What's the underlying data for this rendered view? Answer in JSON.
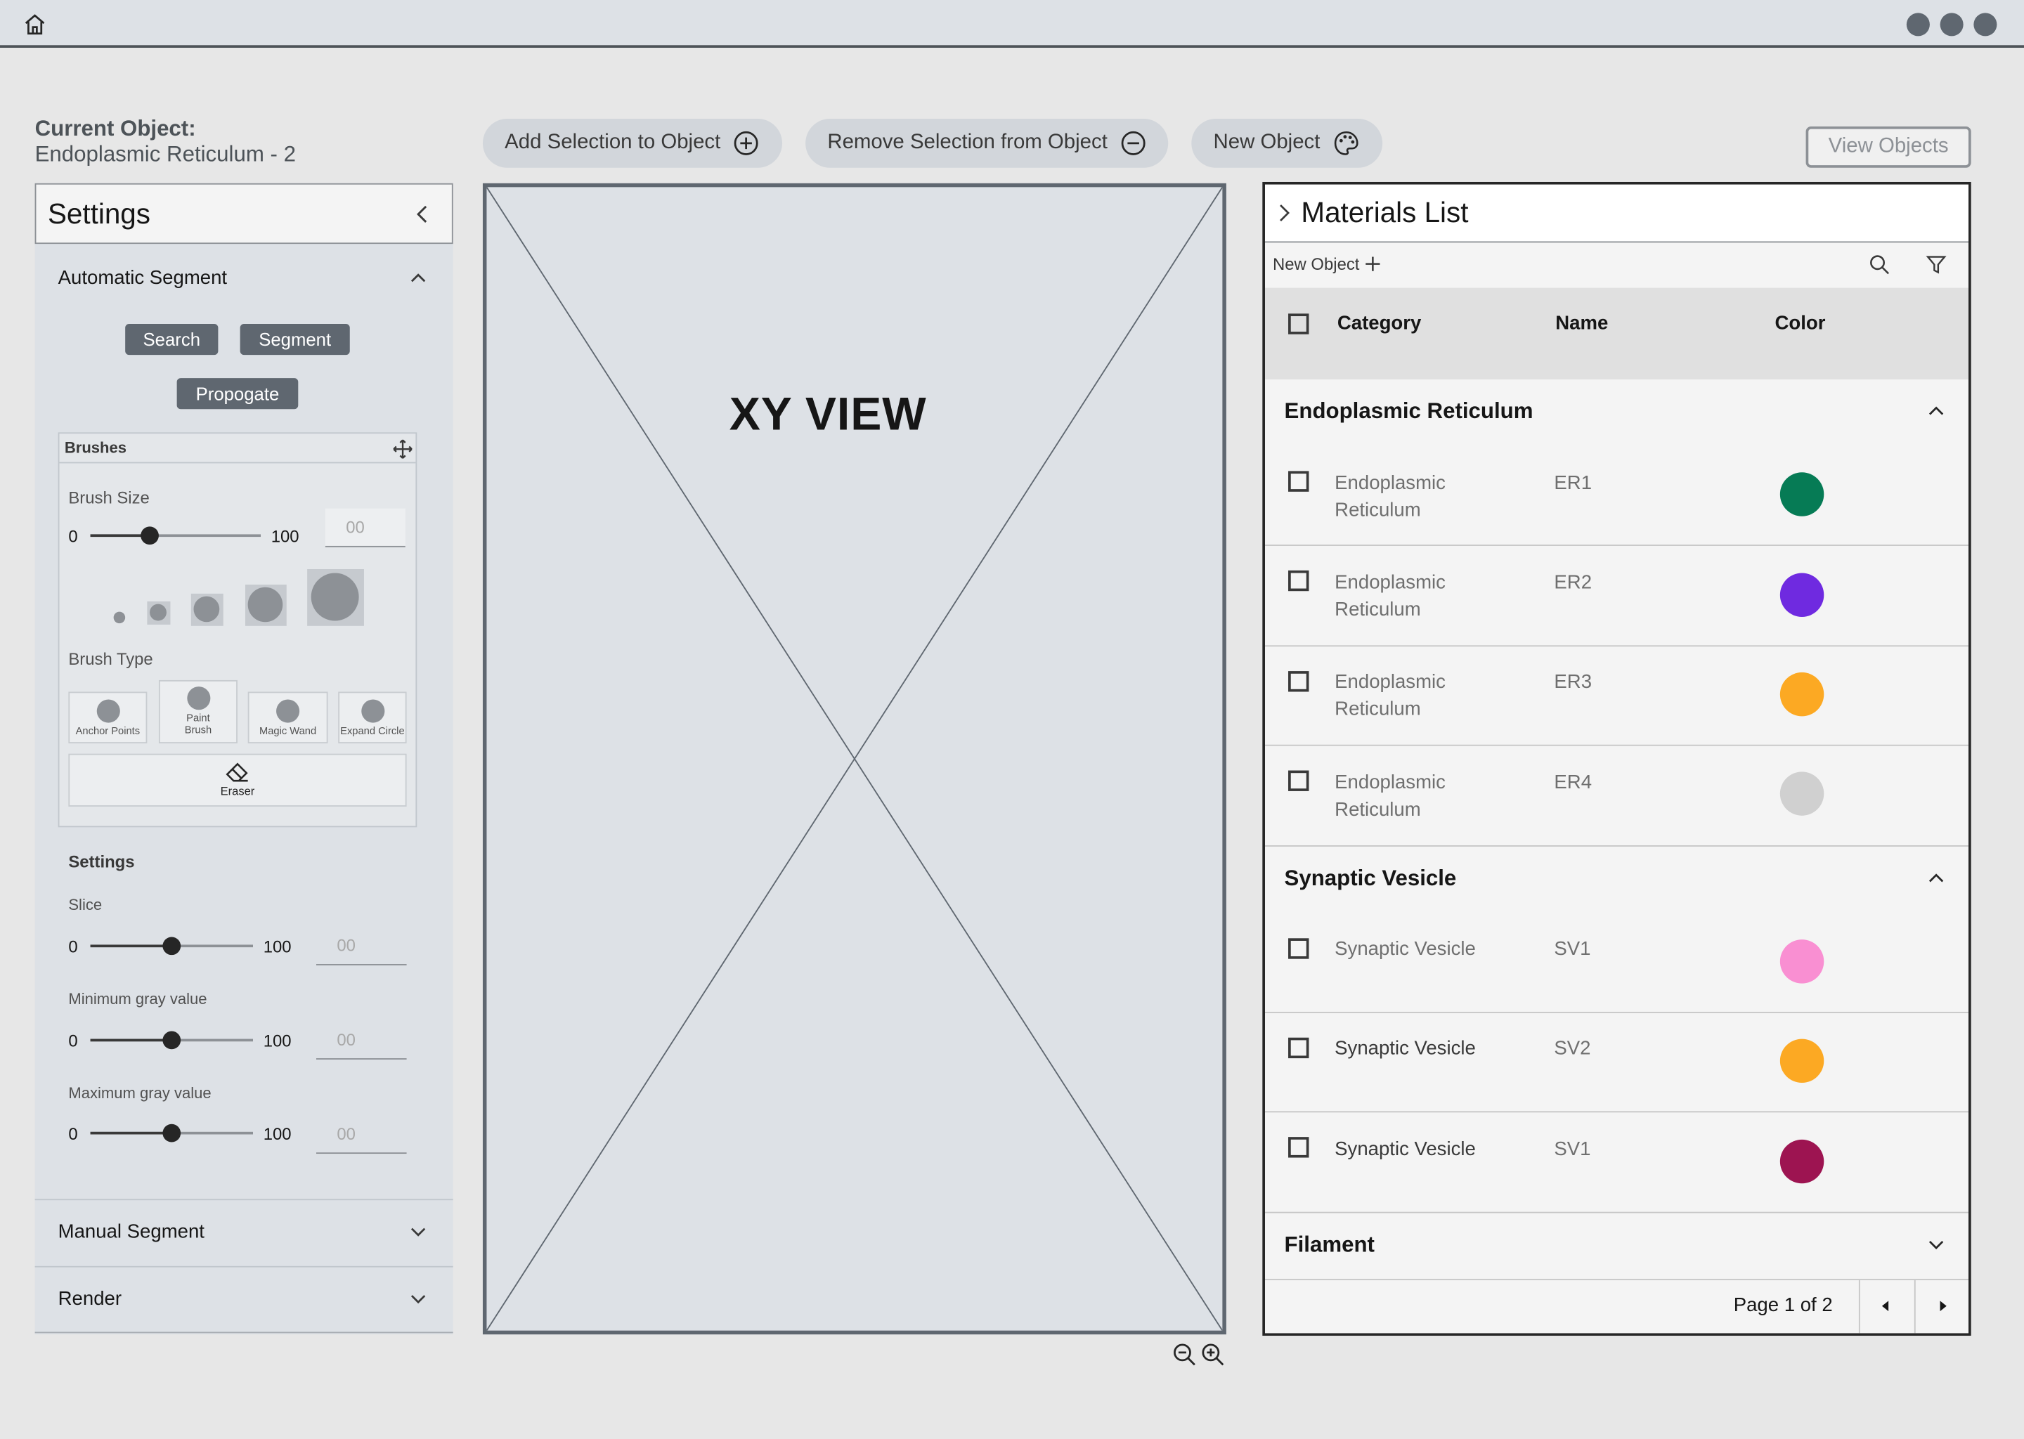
{
  "current_object": {
    "label": "Current Object:",
    "value": "Endoplasmic Reticulum - 2"
  },
  "actions": {
    "add_selection": "Add Selection to Object",
    "remove_selection": "Remove Selection from Object",
    "new_object": "New Object",
    "view_objects": "View Objects"
  },
  "settings": {
    "title": "Settings",
    "automatic_segment": {
      "title": "Automatic Segment",
      "buttons": [
        "Search",
        "Segment",
        "Propogate"
      ],
      "brushes": {
        "title": "Brushes",
        "brush_size_label": "Brush Size",
        "min": "0",
        "max": "100",
        "value_placeholder": "00",
        "brush_size_value_pct": 35,
        "brush_type_label": "Brush Type",
        "brush_types": [
          "Anchor Points",
          "Paint Brush",
          "Magic Wand",
          "Expand Circle"
        ],
        "eraser": "Eraser"
      },
      "settings_label": "Settings",
      "sliders": [
        {
          "label": "Slice",
          "min": "0",
          "max": "100",
          "placeholder": "00",
          "value_pct": 50
        },
        {
          "label": "Minimum gray value",
          "min": "0",
          "max": "100",
          "placeholder": "00",
          "value_pct": 50
        },
        {
          "label": "Maximum gray value",
          "min": "0",
          "max": "100",
          "placeholder": "00",
          "value_pct": 50
        }
      ]
    },
    "manual_segment": "Manual Segment",
    "render": "Render"
  },
  "viewer": {
    "title": "XY VIEW"
  },
  "materials": {
    "title": "Materials List",
    "new_object": "New Object",
    "columns": [
      "Category",
      "Name",
      "Color"
    ],
    "groups": [
      {
        "title": "Endoplasmic Reticulum",
        "rows": [
          {
            "category": "Endoplasmic Reticulum",
            "name": "ER1",
            "color": "#067b55"
          },
          {
            "category": "Endoplasmic Reticulum",
            "name": "ER2",
            "color": "#6f2ae0"
          },
          {
            "category": "Endoplasmic Reticulum",
            "name": "ER3",
            "color": "#fca923"
          },
          {
            "category": "Endoplasmic Reticulum",
            "name": "ER4",
            "color": "#d0d0d0"
          }
        ]
      },
      {
        "title": "Synaptic Vesicle",
        "rows": [
          {
            "category": "Synaptic Vesicle",
            "name": "SV1",
            "color": "#f98fd2"
          },
          {
            "category": "Synaptic Vesicle",
            "name": "SV2",
            "color": "#fca923"
          },
          {
            "category": "Synaptic Vesicle",
            "name": "SV1",
            "color": "#9d1451"
          }
        ]
      },
      {
        "title": "Filament",
        "rows": []
      }
    ],
    "pagination": "Page 1 of 2"
  }
}
